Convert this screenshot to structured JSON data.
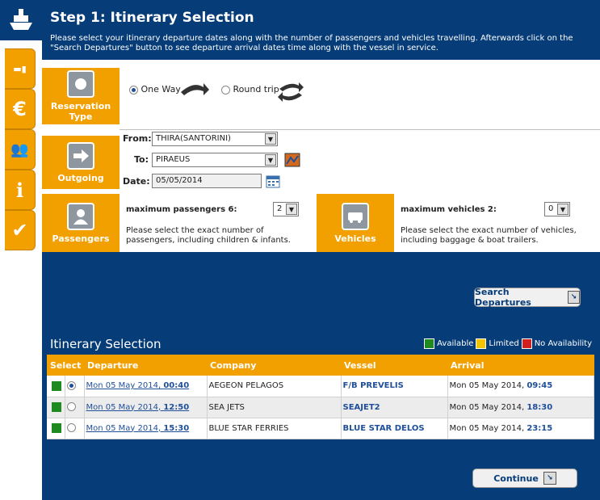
{
  "header": {
    "title": "Step 1: Itinerary Selection",
    "intro": "Please select your itinerary departure dates along with the number of passengers and vehicles travelling. Afterwards click on the \"Search Departures\" button to see departure arrival dates time along with the vessel in service."
  },
  "sidebar": {
    "tabs": [
      "bed-icon",
      "euro-icon",
      "people-icon",
      "info-icon",
      "check-icon"
    ]
  },
  "reservation": {
    "label": "Reservation Type",
    "one_way": "One Way",
    "round_trip": "Round trip",
    "selected": "one_way"
  },
  "outgoing": {
    "label": "Outgoing",
    "from_label": "From:",
    "from_value": "THIRA(SANTORINI)",
    "to_label": "To:",
    "to_value": "PIRAEUS",
    "date_label": "Date:",
    "date_value": "05/05/2014"
  },
  "passengers": {
    "label": "Passengers",
    "max": "maximum passengers 6:",
    "value": "2",
    "hint": "Please select the exact number of passengers, including children & infants."
  },
  "vehicles": {
    "label": "Vehicles",
    "max": "maximum vehicles 2:",
    "value": "0",
    "hint": "Please select the exact number of vehicles, including baggage & boat trailers."
  },
  "search_button": "Search Departures",
  "itinerary": {
    "title": "Itinerary Selection",
    "legend": {
      "available": "Available",
      "limited": "Limited",
      "none": "No Availability",
      "colors": {
        "available": "#1f8a1f",
        "limited": "#f2c400",
        "none": "#d02020"
      }
    },
    "columns": [
      "Select",
      "Departure",
      "Company",
      "Vessel",
      "Arrival"
    ],
    "rows": [
      {
        "dep_date": "Mon 05 May 2014, ",
        "dep_time": "00:40",
        "company": "AEGEON PELAGOS",
        "vessel": "F/B PREVELIS",
        "arr_date": "Mon 05 May 2014, ",
        "arr_time": "09:45",
        "selected": true
      },
      {
        "dep_date": "Mon 05 May 2014, ",
        "dep_time": "12:50",
        "company": "SEA JETS",
        "vessel": "SEAJET2",
        "arr_date": "Mon 05 May 2014, ",
        "arr_time": "18:30",
        "selected": false
      },
      {
        "dep_date": "Mon 05 May 2014, ",
        "dep_time": "15:30",
        "company": "BLUE STAR FERRIES",
        "vessel": "BLUE STAR DELOS",
        "arr_date": "Mon 05 May 2014, ",
        "arr_time": "23:15",
        "selected": false
      }
    ]
  },
  "continue_button": "Continue"
}
